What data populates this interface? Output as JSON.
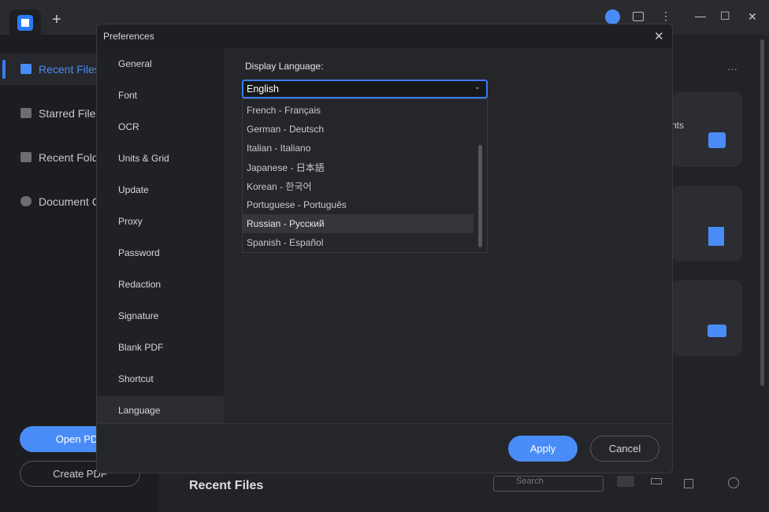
{
  "app": {
    "new_tab": "+",
    "window_controls": {
      "minimize": "—",
      "maximize": "☐",
      "close": "✕"
    }
  },
  "sidebar": {
    "items": [
      {
        "label": "Recent Files",
        "active": true
      },
      {
        "label": "Starred Files"
      },
      {
        "label": "Recent Folders"
      },
      {
        "label": "Document Cloud"
      }
    ],
    "open_pdf": "Open PDF",
    "create_pdf": "Create PDF"
  },
  "main": {
    "more": "···",
    "card_text": "nts",
    "recent_files_heading": "Recent Files",
    "search_placeholder": "Search"
  },
  "dialog": {
    "title": "Preferences",
    "close": "✕",
    "nav": [
      "General",
      "Font",
      "OCR",
      "Units & Grid",
      "Update",
      "Proxy",
      "Password",
      "Redaction",
      "Signature",
      "Blank PDF",
      "Shortcut",
      "Language"
    ],
    "selected_nav": "Language",
    "display_language_label": "Display Language:",
    "selected_language": "English",
    "options": [
      "French - Français",
      "German - Deutsch",
      "Italian - Italiano",
      "Japanese - 日本語",
      "Korean - 한국어",
      "Portuguese - Português",
      "Russian - Русский",
      "Spanish - Español"
    ],
    "hovered_option": "Russian - Русский",
    "apply": "Apply",
    "cancel": "Cancel"
  },
  "colors": {
    "accent": "#4a8cf7",
    "bg": "#222327"
  }
}
